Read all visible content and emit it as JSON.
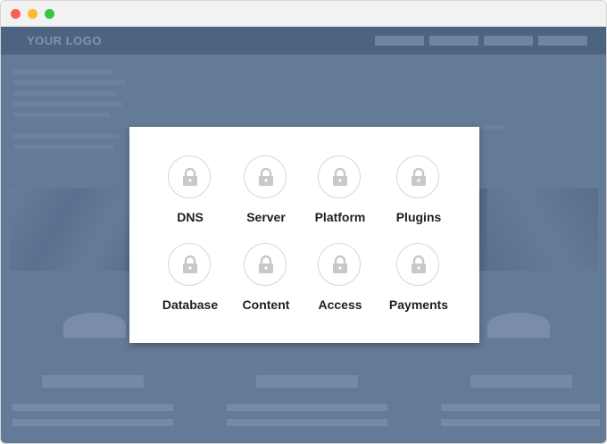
{
  "window": {
    "traffic_lights": [
      "close",
      "minimize",
      "zoom"
    ],
    "colors": {
      "close": "#fc5f57",
      "minimize": "#fdbb2d",
      "zoom": "#33c748"
    }
  },
  "site": {
    "logo": "YOUR LOGO",
    "colors": {
      "header": "#4d6382",
      "background": "#647b98",
      "hero": "#546b8a"
    }
  },
  "modal": {
    "items": [
      {
        "label": "DNS",
        "icon": "lock-icon"
      },
      {
        "label": "Server",
        "icon": "lock-icon"
      },
      {
        "label": "Platform",
        "icon": "lock-icon"
      },
      {
        "label": "Plugins",
        "icon": "lock-icon"
      },
      {
        "label": "Database",
        "icon": "lock-icon"
      },
      {
        "label": "Content",
        "icon": "lock-icon"
      },
      {
        "label": "Access",
        "icon": "lock-icon"
      },
      {
        "label": "Payments",
        "icon": "lock-icon"
      }
    ],
    "colors": {
      "icon": "#c8c8c8",
      "label": "#1f1f1f"
    }
  }
}
